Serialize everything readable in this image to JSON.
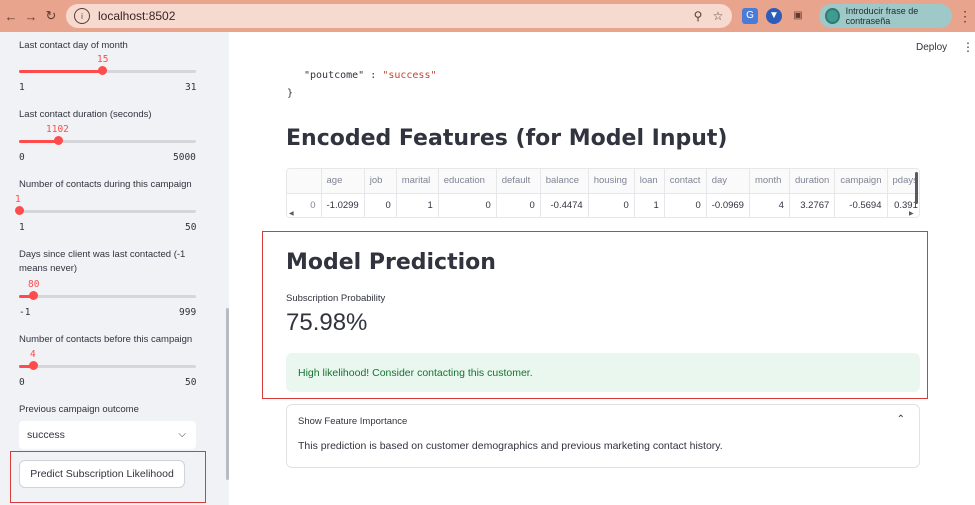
{
  "browser": {
    "url": "localhost:8502",
    "profile_label": "Introducir frase de contraseña"
  },
  "header": {
    "deploy_label": "Deploy"
  },
  "sidebar": {
    "sliders": [
      {
        "label": "Last contact day of month",
        "value": "15",
        "min": "1",
        "max": "31",
        "fraction": 0.467
      },
      {
        "label": "Last contact duration (seconds)",
        "value": "1102",
        "min": "0",
        "max": "5000",
        "fraction": 0.22
      },
      {
        "label": "Number of contacts during this campaign",
        "value": "1",
        "min": "1",
        "max": "50",
        "fraction": 0.0
      },
      {
        "label": "Days since client was last contacted (-1 means never)",
        "value": "80",
        "min": "-1",
        "max": "999",
        "fraction": 0.081
      },
      {
        "label": "Number of contacts before this campaign",
        "value": "4",
        "min": "0",
        "max": "50",
        "fraction": 0.08
      }
    ],
    "outcome_label": "Previous campaign outcome",
    "outcome_value": "success",
    "predict_button": "Predict Subscription Likelihood"
  },
  "json_view": {
    "key": "\"poutcome\"",
    "colon": ":",
    "value": "\"success\"",
    "close_brace": "}"
  },
  "encoded": {
    "title": "Encoded Features (for Model Input)",
    "columns": [
      "",
      "age",
      "job",
      "marital",
      "education",
      "default",
      "balance",
      "housing",
      "loan",
      "contact",
      "day",
      "month",
      "duration",
      "campaign",
      "pdays"
    ],
    "row": [
      "0",
      "-1.0299",
      "0",
      "1",
      "0",
      "0",
      "-0.4474",
      "0",
      "1",
      "0",
      "-0.0969",
      "4",
      "3.2767",
      "-0.5694",
      "0.391"
    ]
  },
  "prediction": {
    "title": "Model Prediction",
    "metric_label": "Subscription Probability",
    "metric_value": "75.98%",
    "success_message": "High likelihood! Consider contacting this customer."
  },
  "expander": {
    "title": "Show Feature Importance",
    "body": "This prediction is based on customer demographics and previous marketing contact history."
  },
  "colors": {
    "accent": "#ff4b4b",
    "highlight_border": "#d93a3a",
    "success_bg": "#e9f7ee",
    "success_text": "#177233"
  }
}
